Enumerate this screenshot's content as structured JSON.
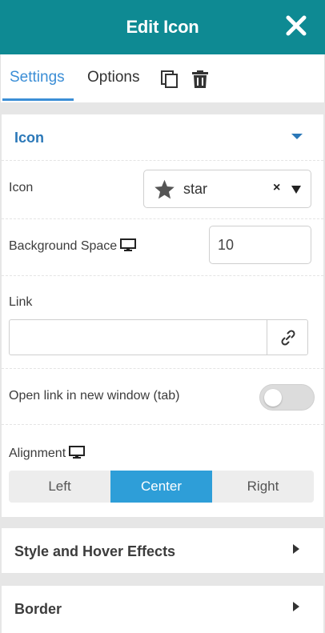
{
  "header": {
    "title": "Edit Icon"
  },
  "tabs": {
    "settings": "Settings",
    "options": "Options"
  },
  "sections": {
    "icon": "Icon",
    "style_hover": "Style and Hover Effects",
    "border": "Border"
  },
  "fields": {
    "icon": {
      "label": "Icon",
      "value": "star",
      "clear": "×"
    },
    "background_space": {
      "label": "Background Space",
      "value": "10"
    },
    "link": {
      "label": "Link",
      "value": ""
    },
    "new_window": {
      "label": "Open link in new window (tab)",
      "enabled": false
    },
    "alignment": {
      "label": "Alignment",
      "options": [
        "Left",
        "Center",
        "Right"
      ],
      "selected": "Center"
    }
  },
  "colors": {
    "header": "#0e8a93",
    "accent": "#3b8ed6",
    "selected": "#2e9ed8"
  },
  "icons": [
    "close-icon",
    "copy-icon",
    "trash-icon",
    "star-icon",
    "monitor-icon",
    "link-icon"
  ]
}
